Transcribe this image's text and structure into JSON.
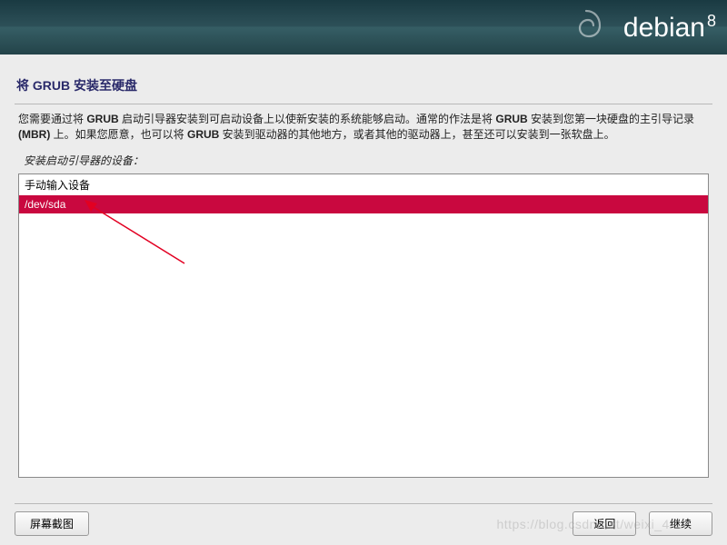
{
  "banner": {
    "brand": "debian",
    "version": "8"
  },
  "page": {
    "title": "将 GRUB 安装至硬盘",
    "desc_prefix": "您需要通过将 ",
    "desc_b1": "GRUB",
    "desc_mid1": " 启动引导器安装到可启动设备上以使新安装的系统能够启动。通常的作法是将 ",
    "desc_b2": "GRUB",
    "desc_mid2": " 安装到您第一块硬盘的主引导记录 ",
    "desc_b3": "(MBR)",
    "desc_mid3": " 上。如果您愿意，也可以将 ",
    "desc_b4": "GRUB",
    "desc_suffix": " 安装到驱动器的其他地方，或者其他的驱动器上，甚至还可以安装到一张软盘上。",
    "prompt": "安装启动引导器的设备：",
    "options": {
      "manual": "手动输入设备",
      "selected": "/dev/sda"
    }
  },
  "buttons": {
    "screenshot": "屏幕截图",
    "back": "返回",
    "continue": "继续"
  },
  "watermark": "https://blog.csdn.net/weixi_4..."
}
